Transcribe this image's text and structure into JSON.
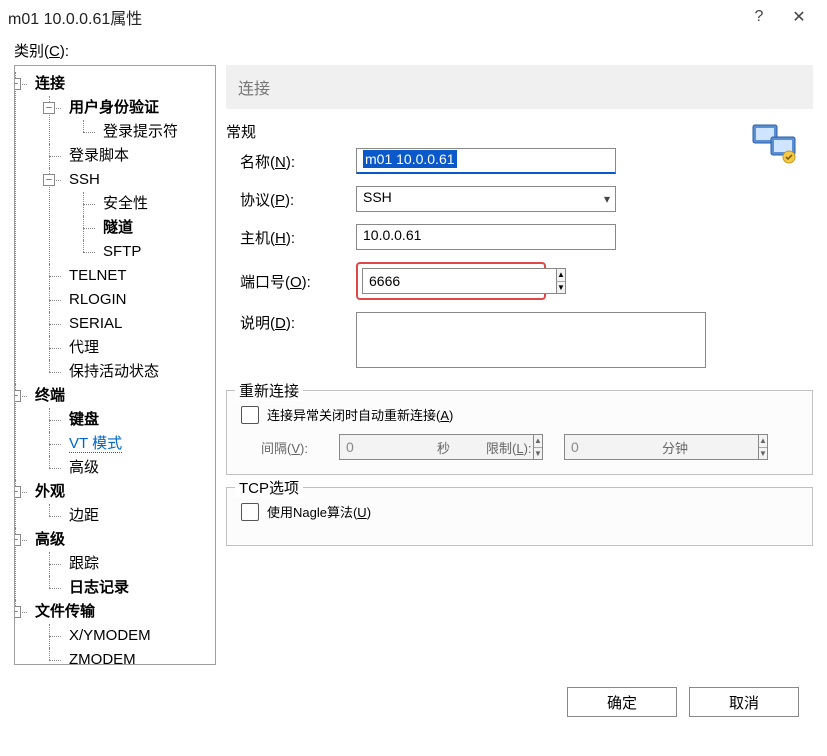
{
  "title": "m01  10.0.0.61属性",
  "category_label_pre": "类别(",
  "category_label_key": "C",
  "category_label_post": "):",
  "tree": {
    "connection": "连接",
    "user_auth": "用户身份验证",
    "login_prompt": "登录提示符",
    "login_script": "登录脚本",
    "ssh": "SSH",
    "security": "安全性",
    "tunnel": "隧道",
    "sftp": "SFTP",
    "telnet": "TELNET",
    "rlogin": "RLOGIN",
    "serial": "SERIAL",
    "proxy": "代理",
    "keepalive": "保持活动状态",
    "terminal": "终端",
    "keyboard": "键盘",
    "vt_mode": "VT 模式",
    "advanced": "高级",
    "appearance": "外观",
    "margin": "边距",
    "advanced2": "高级",
    "trace": "跟踪",
    "log": "日志记录",
    "file_transfer": "文件传输",
    "xymodem": "X/YMODEM",
    "zmodem": "ZMODEM"
  },
  "panel": {
    "header": "连接",
    "general": "常规",
    "name_label_pre": "名称(",
    "name_label_key": "N",
    "name_label_post": "):",
    "name_value": "m01  10.0.0.61",
    "protocol_label_pre": "协议(",
    "protocol_label_key": "P",
    "protocol_label_post": "):",
    "protocol_value": "SSH",
    "host_label_pre": "主机(",
    "host_label_key": "H",
    "host_label_post": "):",
    "host_value": "10.0.0.61",
    "port_label_pre": "端口号(",
    "port_label_key": "O",
    "port_label_post": "):",
    "port_value": "6666",
    "desc_label_pre": "说明(",
    "desc_label_key": "D",
    "desc_label_post": "):",
    "reconnect": {
      "legend": "重新连接",
      "checkbox_pre": "连接异常关闭时自动重新连接(",
      "checkbox_key": "A",
      "checkbox_post": ")",
      "interval_pre": "间隔(",
      "interval_key": "V",
      "interval_post": "):",
      "interval_value": "0",
      "interval_unit": "秒",
      "limit_pre": "限制(",
      "limit_key": "L",
      "limit_post": "):",
      "limit_value": "0",
      "limit_unit": "分钟"
    },
    "tcp": {
      "legend": "TCP选项",
      "nagle_pre": "使用Nagle算法(",
      "nagle_key": "U",
      "nagle_post": ")"
    }
  },
  "footer": {
    "ok": "确定",
    "cancel": "取消"
  }
}
